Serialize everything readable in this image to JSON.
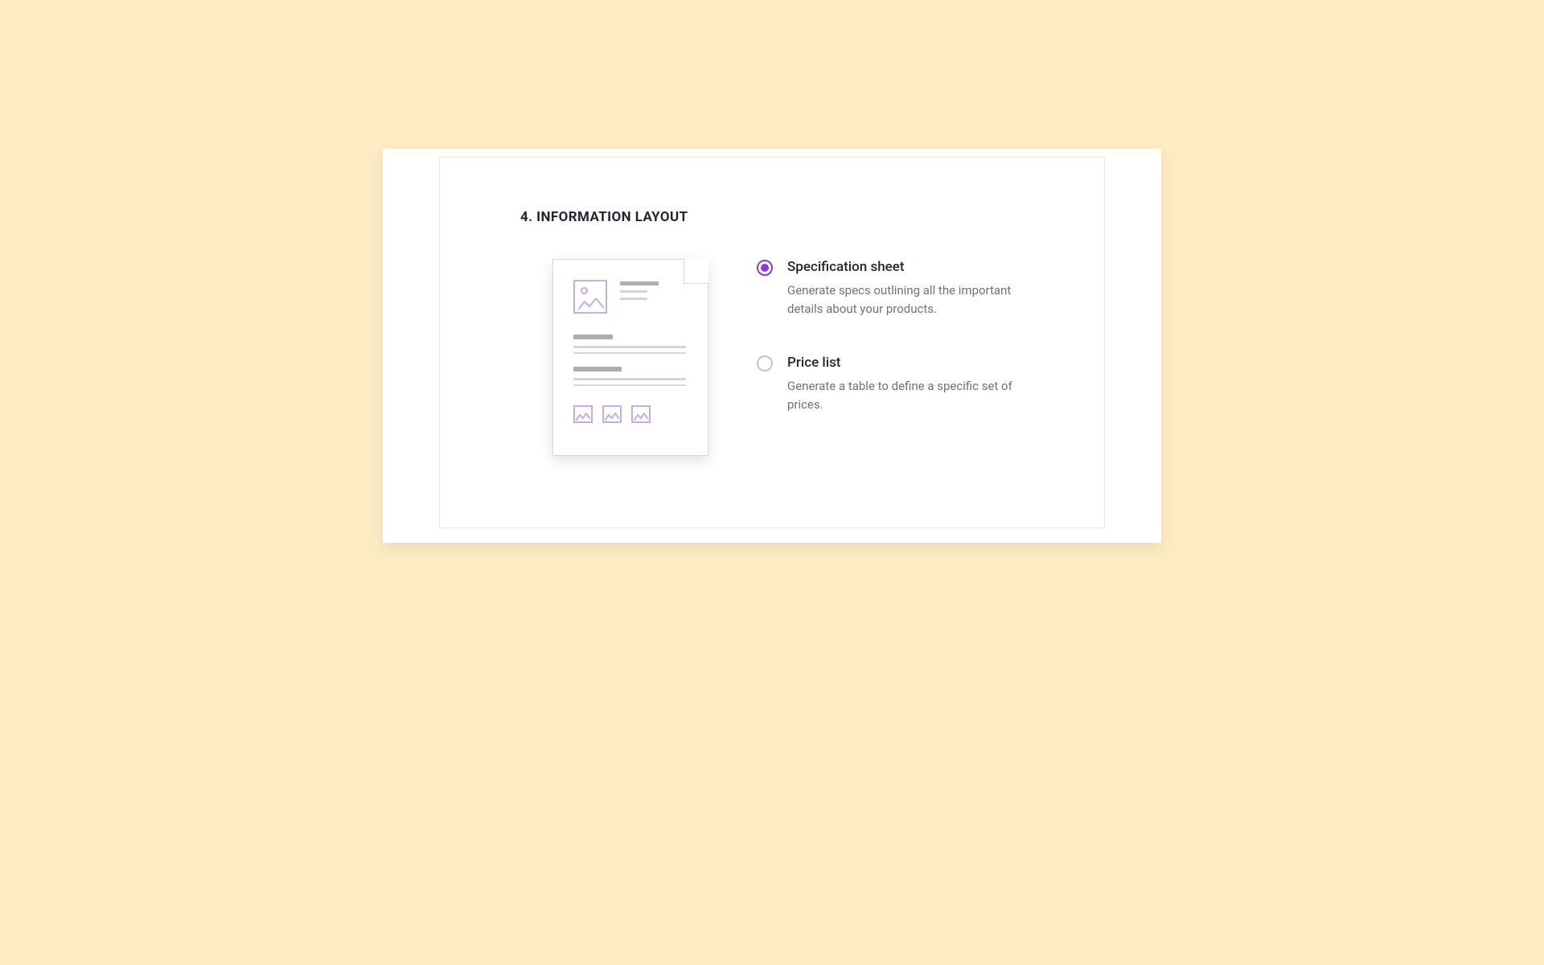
{
  "section": {
    "title": "4. INFORMATION LAYOUT"
  },
  "options": [
    {
      "label": "Specification sheet",
      "description": "Generate specs outlining all the important details about your products.",
      "selected": true
    },
    {
      "label": "Price list",
      "description": "Generate a table to define a specific set of prices.",
      "selected": false
    }
  ]
}
